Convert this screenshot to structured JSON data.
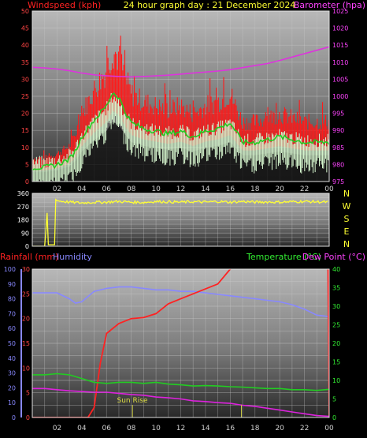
{
  "header": {
    "left_title": "Windspeed (kph)",
    "center_title": "24 hour graph day : 21 December 2024",
    "right_title": "Barometer (hpa)"
  },
  "colors": {
    "wind_gust": "#ff1a1a",
    "wind_avg": "#22cc22",
    "wind_light": "#d8f8d0",
    "barometer": "#dd33dd",
    "direction": "#ffff33",
    "rainfall": "#ff2222",
    "humidity": "#8888ff",
    "temperature": "#22cc22",
    "dewpoint": "#dd22dd",
    "sunrise": "#cccc44",
    "axis_text_left": "#ff4444",
    "axis_text_right": "#ff44ff",
    "axis_text_temp": "#33ee33"
  },
  "x_tick_labels": [
    "02",
    "04",
    "06",
    "08",
    "10",
    "12",
    "14",
    "16",
    "18",
    "20",
    "22",
    "00"
  ],
  "wind_panel": {
    "y_left_ticks": [
      "0",
      "5",
      "10",
      "15",
      "20",
      "25",
      "30",
      "35",
      "40",
      "45",
      "50"
    ],
    "y_right_ticks": [
      "975",
      "980",
      "985",
      "990",
      "995",
      "1000",
      "1005",
      "1010",
      "1015",
      "1020",
      "1025"
    ]
  },
  "direction_panel": {
    "y_ticks": [
      "0",
      "90",
      "180",
      "270",
      "360"
    ],
    "compass": [
      "N",
      "W",
      "S",
      "E",
      "N"
    ]
  },
  "lower_panel": {
    "rain_label": "Rainfall (mm)",
    "humidity_label": "Humidity",
    "temp_label": "Temperature (°C)",
    "dew_label": "Dew Point (°C)",
    "humidity_ticks": [
      "0",
      "10",
      "20",
      "30",
      "40",
      "50",
      "60",
      "70",
      "80",
      "90",
      "100"
    ],
    "rain_ticks": [
      "0",
      "5",
      "10",
      "15",
      "20",
      "25",
      "30"
    ],
    "temp_ticks": [
      "0",
      "5",
      "10",
      "15",
      "20",
      "25",
      "30",
      "35",
      "40"
    ],
    "sun_rise_label": "Sun Rise"
  },
  "chart_data": [
    {
      "type": "line",
      "title": "24 hour graph day : 21 December 2024",
      "x_unit": "hour",
      "xlim": [
        0,
        24
      ],
      "x_ticks": [
        "02",
        "04",
        "06",
        "08",
        "10",
        "12",
        "14",
        "16",
        "18",
        "20",
        "22",
        "00"
      ],
      "ylabel": "Windspeed (kph)",
      "ylim": [
        0,
        50
      ],
      "y2label": "Barometer (hpa)",
      "y2lim": [
        975,
        1025
      ],
      "series": [
        {
          "name": "Windspeed (kph)",
          "axis": "left",
          "x": [
            0,
            1,
            2,
            3,
            3.5,
            4,
            5,
            6,
            6.5,
            7,
            7.5,
            8,
            9,
            10,
            11,
            12,
            13,
            14,
            15,
            16,
            17,
            18,
            19,
            20,
            21,
            22,
            23,
            24
          ],
          "y": [
            5,
            5,
            6,
            8,
            11,
            16,
            22,
            27,
            32,
            30,
            25,
            21,
            19,
            18,
            17,
            18,
            16,
            18,
            19,
            21,
            14,
            14,
            15,
            16,
            15,
            14,
            14,
            14
          ]
        },
        {
          "name": "Barometer (hpa)",
          "axis": "right",
          "x": [
            0,
            1,
            2,
            3,
            4,
            5,
            6,
            7,
            8,
            9,
            10,
            11,
            12,
            13,
            14,
            15,
            16,
            17,
            18,
            19,
            20,
            21,
            22,
            23,
            24
          ],
          "y": [
            1008.5,
            1008.3,
            1008,
            1007.5,
            1006.8,
            1006.3,
            1006,
            1005.8,
            1005.7,
            1005.8,
            1006,
            1006.2,
            1006.5,
            1006.8,
            1007.1,
            1007.4,
            1007.8,
            1008.4,
            1009,
            1009.6,
            1010.5,
            1011.5,
            1012.5,
            1013.5,
            1014.5
          ]
        }
      ]
    },
    {
      "type": "line",
      "title": "",
      "x_unit": "hour",
      "xlim": [
        0,
        24
      ],
      "ylabel": "",
      "ylim": [
        0,
        360
      ],
      "series": [
        {
          "name": "",
          "x": [
            0,
            1,
            1.3,
            1.5,
            1.7,
            2,
            3,
            4,
            5,
            6,
            7,
            8,
            9,
            10,
            11,
            12,
            13,
            14,
            15,
            16,
            17,
            18,
            19,
            20,
            21,
            22,
            23,
            24
          ],
          "y": [
            0,
            0,
            340,
            20,
            335,
            310,
            300,
            295,
            300,
            300,
            305,
            300,
            298,
            305,
            302,
            300,
            303,
            300,
            305,
            300,
            305,
            300,
            302,
            300,
            303,
            305,
            302,
            300
          ]
        }
      ]
    },
    {
      "type": "line",
      "title": "",
      "x_unit": "hour",
      "xlim": [
        0,
        24
      ],
      "ylabel": "Rainfall (mm)",
      "ylim": [
        0,
        30
      ],
      "y2label": "Temperature (°C)",
      "y2lim": [
        0,
        40
      ],
      "series": [
        {
          "name": "Humidity",
          "axis": "humidity",
          "x": [
            0,
            1,
            2,
            3,
            3.5,
            4,
            5,
            6,
            7,
            8,
            9,
            10,
            11,
            12,
            13,
            14,
            15,
            16,
            17,
            18,
            19,
            20,
            21,
            22,
            23,
            24
          ],
          "y": [
            84,
            84,
            84,
            80,
            77,
            78,
            85,
            87,
            88,
            88,
            87,
            86,
            86,
            85,
            85,
            84,
            83,
            82,
            81,
            80,
            79,
            78,
            76,
            73,
            69,
            68
          ]
        },
        {
          "name": "Rainfall (mm)",
          "axis": "rain",
          "x": [
            0,
            4.5,
            5,
            5.5,
            6,
            7,
            8,
            9,
            10,
            11,
            12,
            13,
            14,
            15,
            16,
            17,
            18,
            19,
            20,
            21,
            22,
            23,
            23.9,
            24
          ],
          "y": [
            0,
            0,
            2,
            11,
            17,
            19,
            20,
            20.2,
            21,
            23,
            24,
            25,
            26,
            27,
            30,
            31,
            31.5,
            31.5,
            31.5,
            31.5,
            31.5,
            31.5,
            31.5,
            0
          ]
        },
        {
          "name": "Temperature (°C)",
          "axis": "temp",
          "x": [
            0,
            1,
            2,
            3,
            4,
            5,
            6,
            7,
            8,
            9,
            10,
            11,
            12,
            13,
            14,
            15,
            16,
            17,
            18,
            19,
            20,
            21,
            22,
            23,
            24
          ],
          "y": [
            11.5,
            11.5,
            11.8,
            11.5,
            10.5,
            9.5,
            9.2,
            9.5,
            9.5,
            9.2,
            9.5,
            9,
            8.8,
            8.5,
            8.6,
            8.5,
            8.3,
            8.2,
            8,
            7.8,
            7.8,
            7.5,
            7.5,
            7.3,
            7.6
          ]
        },
        {
          "name": "Dew Point (°C)",
          "axis": "temp",
          "x": [
            0,
            1,
            2,
            3,
            4,
            5,
            6,
            7,
            8,
            9,
            10,
            11,
            12,
            13,
            14,
            15,
            16,
            17,
            18,
            19,
            20,
            21,
            22,
            23,
            24
          ],
          "y": [
            7.8,
            7.8,
            7.5,
            7.2,
            7,
            6.8,
            6.8,
            6.5,
            6.2,
            6,
            5.5,
            5.3,
            5,
            4.5,
            4.3,
            4,
            3.8,
            3.3,
            3,
            2.5,
            2,
            1.5,
            1,
            0.5,
            0.3
          ]
        }
      ],
      "markers": [
        {
          "label": "Sun Rise",
          "x": 8.1
        }
      ]
    }
  ]
}
